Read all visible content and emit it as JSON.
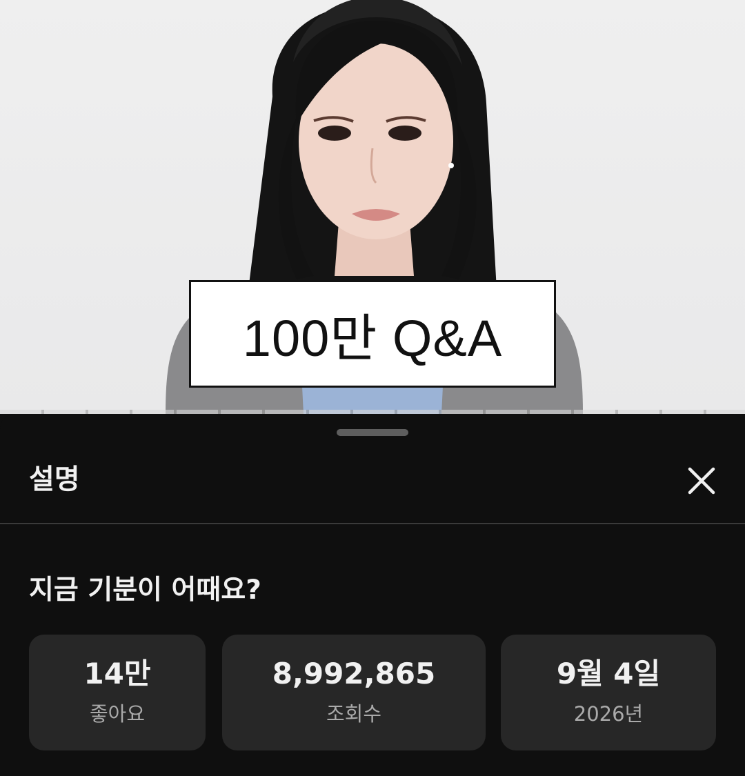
{
  "video": {
    "caption": "100만 Q&A"
  },
  "sheet": {
    "title": "설명",
    "close_icon": "close-icon"
  },
  "description": {
    "title": "지금 기분이 어때요?"
  },
  "stats": {
    "likes_value": "14만",
    "likes_label": "좋아요",
    "views_value": "8,992,865",
    "views_label": "조회수",
    "date_value": "9월 4일",
    "date_label": "2026년"
  },
  "colors": {
    "sheet_background": "#0f0f0f",
    "card_background": "#272727",
    "primary_text": "#f1f1f1",
    "secondary_text": "#aaaaaa"
  }
}
